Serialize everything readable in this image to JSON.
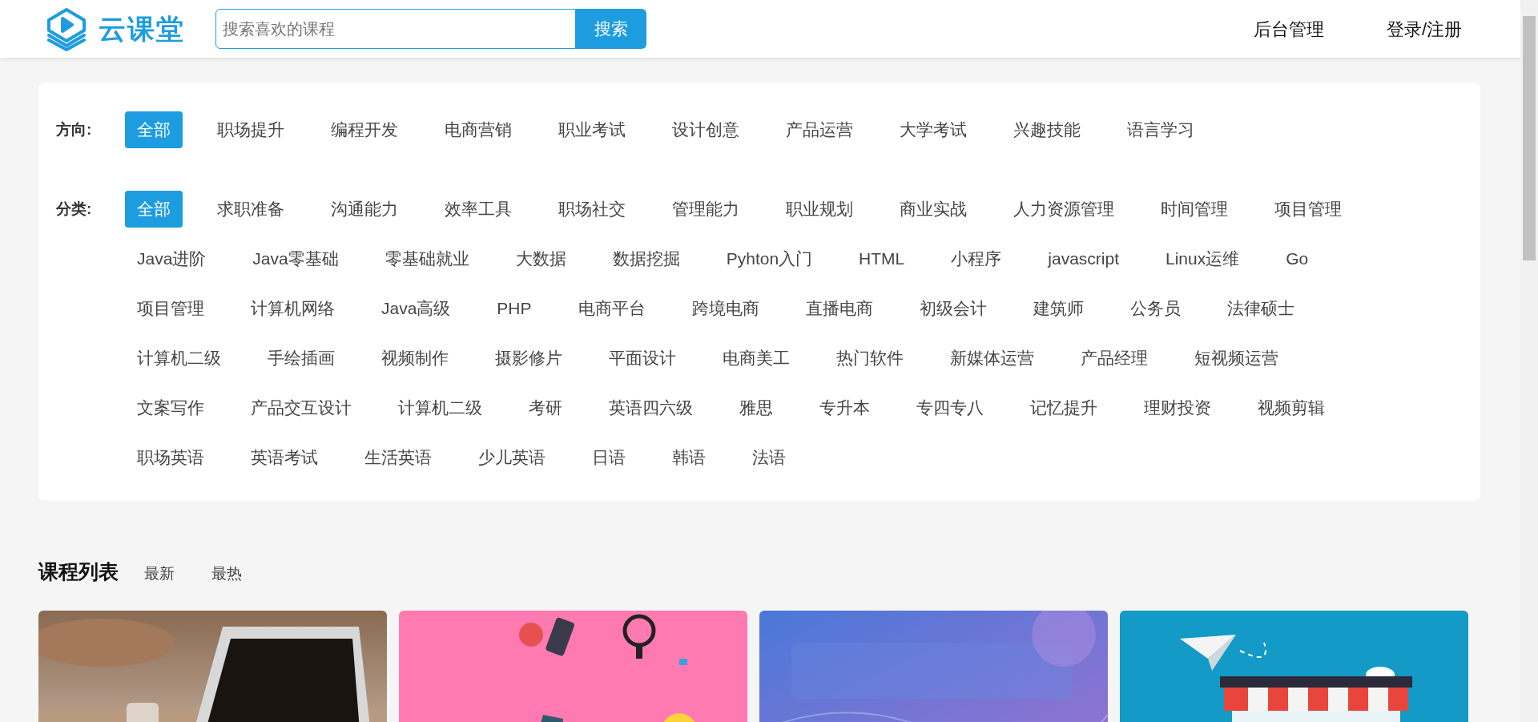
{
  "header": {
    "logo": "云课堂",
    "search": {
      "placeholder": "搜索喜欢的课程",
      "button": "搜索"
    },
    "nav": [
      "后台管理",
      "登录/注册"
    ]
  },
  "filters": [
    {
      "label": "方向:",
      "items": [
        {
          "label": "全部",
          "selected": true
        },
        {
          "label": "职场提升",
          "selected": false
        },
        {
          "label": "编程开发",
          "selected": false
        },
        {
          "label": "电商营销",
          "selected": false
        },
        {
          "label": "职业考试",
          "selected": false
        },
        {
          "label": "设计创意",
          "selected": false
        },
        {
          "label": "产品运营",
          "selected": false
        },
        {
          "label": "大学考试",
          "selected": false
        },
        {
          "label": "兴趣技能",
          "selected": false
        },
        {
          "label": "语言学习",
          "selected": false
        }
      ]
    },
    {
      "label": "分类:",
      "items": [
        {
          "label": "全部",
          "selected": true
        },
        {
          "label": "求职准备",
          "selected": false
        },
        {
          "label": "沟通能力",
          "selected": false
        },
        {
          "label": "效率工具",
          "selected": false
        },
        {
          "label": "职场社交",
          "selected": false
        },
        {
          "label": "管理能力",
          "selected": false
        },
        {
          "label": "职业规划",
          "selected": false
        },
        {
          "label": "商业实战",
          "selected": false
        },
        {
          "label": "人力资源管理",
          "selected": false
        },
        {
          "label": "时间管理",
          "selected": false
        },
        {
          "label": "项目管理",
          "selected": false
        },
        {
          "label": "Java进阶",
          "selected": false
        },
        {
          "label": "Java零基础",
          "selected": false
        },
        {
          "label": "零基础就业",
          "selected": false
        },
        {
          "label": "大数据",
          "selected": false
        },
        {
          "label": "数据挖掘",
          "selected": false
        },
        {
          "label": "Pyhton入门",
          "selected": false
        },
        {
          "label": "HTML",
          "selected": false
        },
        {
          "label": "小程序",
          "selected": false
        },
        {
          "label": "javascript",
          "selected": false
        },
        {
          "label": "Linux运维",
          "selected": false
        },
        {
          "label": "Go",
          "selected": false
        },
        {
          "label": "项目管理",
          "selected": false
        },
        {
          "label": "计算机网络",
          "selected": false
        },
        {
          "label": "Java高级",
          "selected": false
        },
        {
          "label": "PHP",
          "selected": false
        },
        {
          "label": "电商平台",
          "selected": false
        },
        {
          "label": "跨境电商",
          "selected": false
        },
        {
          "label": "直播电商",
          "selected": false
        },
        {
          "label": "初级会计",
          "selected": false
        },
        {
          "label": "建筑师",
          "selected": false
        },
        {
          "label": "公务员",
          "selected": false
        },
        {
          "label": "法律硕士",
          "selected": false
        },
        {
          "label": "计算机二级",
          "selected": false
        },
        {
          "label": "手绘插画",
          "selected": false
        },
        {
          "label": "视频制作",
          "selected": false
        },
        {
          "label": "摄影修片",
          "selected": false
        },
        {
          "label": "平面设计",
          "selected": false
        },
        {
          "label": "电商美工",
          "selected": false
        },
        {
          "label": "热门软件",
          "selected": false
        },
        {
          "label": "新媒体运营",
          "selected": false
        },
        {
          "label": "产品经理",
          "selected": false
        },
        {
          "label": "短视频运营",
          "selected": false
        },
        {
          "label": "文案写作",
          "selected": false
        },
        {
          "label": "产品交互设计",
          "selected": false
        },
        {
          "label": "计算机二级",
          "selected": false
        },
        {
          "label": "考研",
          "selected": false
        },
        {
          "label": "英语四六级",
          "selected": false
        },
        {
          "label": "雅思",
          "selected": false
        },
        {
          "label": "专升本",
          "selected": false
        },
        {
          "label": "专四专八",
          "selected": false
        },
        {
          "label": "记忆提升",
          "selected": false
        },
        {
          "label": "理财投资",
          "selected": false
        },
        {
          "label": "视频剪辑",
          "selected": false
        },
        {
          "label": "职场英语",
          "selected": false
        },
        {
          "label": "英语考试",
          "selected": false
        },
        {
          "label": "生活英语",
          "selected": false
        },
        {
          "label": "少儿英语",
          "selected": false
        },
        {
          "label": "日语",
          "selected": false
        },
        {
          "label": "韩语",
          "selected": false
        },
        {
          "label": "法语",
          "selected": false
        }
      ]
    }
  ],
  "course_list": {
    "title": "课程列表",
    "sorts": [
      "最新",
      "最热"
    ]
  }
}
